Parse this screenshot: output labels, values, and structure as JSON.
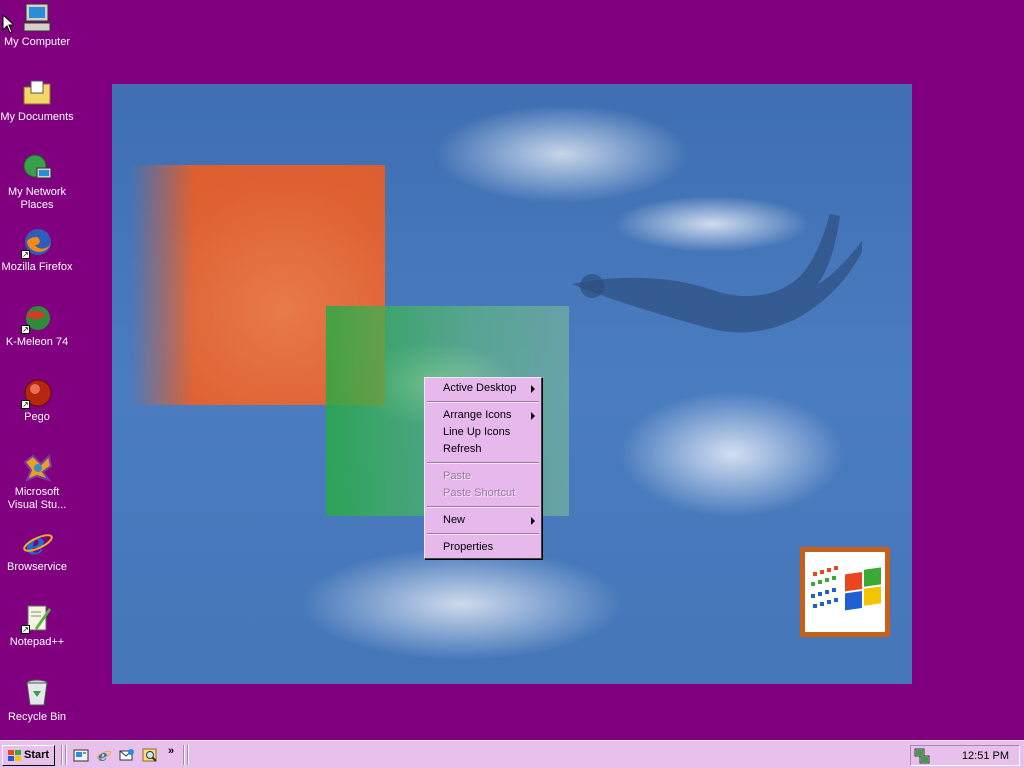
{
  "desktop": {
    "background_color": "#800080",
    "icons": [
      {
        "label": "My Computer",
        "icon": "computer-icon"
      },
      {
        "label": "My Documents",
        "icon": "folder-documents-icon"
      },
      {
        "label": "My Network Places",
        "icon": "network-places-icon"
      },
      {
        "label": "Mozilla Firefox",
        "icon": "firefox-icon"
      },
      {
        "label": "K-Meleon 74",
        "icon": "kmeleon-icon"
      },
      {
        "label": "Pego",
        "icon": "pego-icon"
      },
      {
        "label": "Microsoft Visual Stu...",
        "icon": "visual-studio-icon"
      },
      {
        "label": "Browservice",
        "icon": "internet-explorer-icon"
      },
      {
        "label": "Notepad++",
        "icon": "notepadpp-icon"
      },
      {
        "label": "Recycle Bin",
        "icon": "recycle-bin-icon"
      }
    ]
  },
  "context_menu": {
    "items": [
      {
        "label": "Active Desktop",
        "submenu": true,
        "disabled": false
      },
      {
        "label": "Arrange Icons",
        "submenu": true,
        "disabled": false
      },
      {
        "label": "Line Up Icons",
        "submenu": false,
        "disabled": false
      },
      {
        "label": "Refresh",
        "submenu": false,
        "disabled": false
      },
      {
        "label": "Paste",
        "submenu": false,
        "disabled": true
      },
      {
        "label": "Paste Shortcut",
        "submenu": false,
        "disabled": true
      },
      {
        "label": "New",
        "submenu": true,
        "disabled": false
      },
      {
        "label": "Properties",
        "submenu": false,
        "disabled": false
      }
    ],
    "background_color": "#e6b8ec"
  },
  "taskbar": {
    "start_label": "Start",
    "quick_launch": [
      "show-desktop-icon",
      "internet-explorer-icon",
      "outlook-express-icon",
      "search-icon"
    ],
    "overflow_label": "»",
    "clock": "12:51 PM",
    "tray_icon": "network-connection-icon",
    "background_color": "#e8c0ec"
  }
}
